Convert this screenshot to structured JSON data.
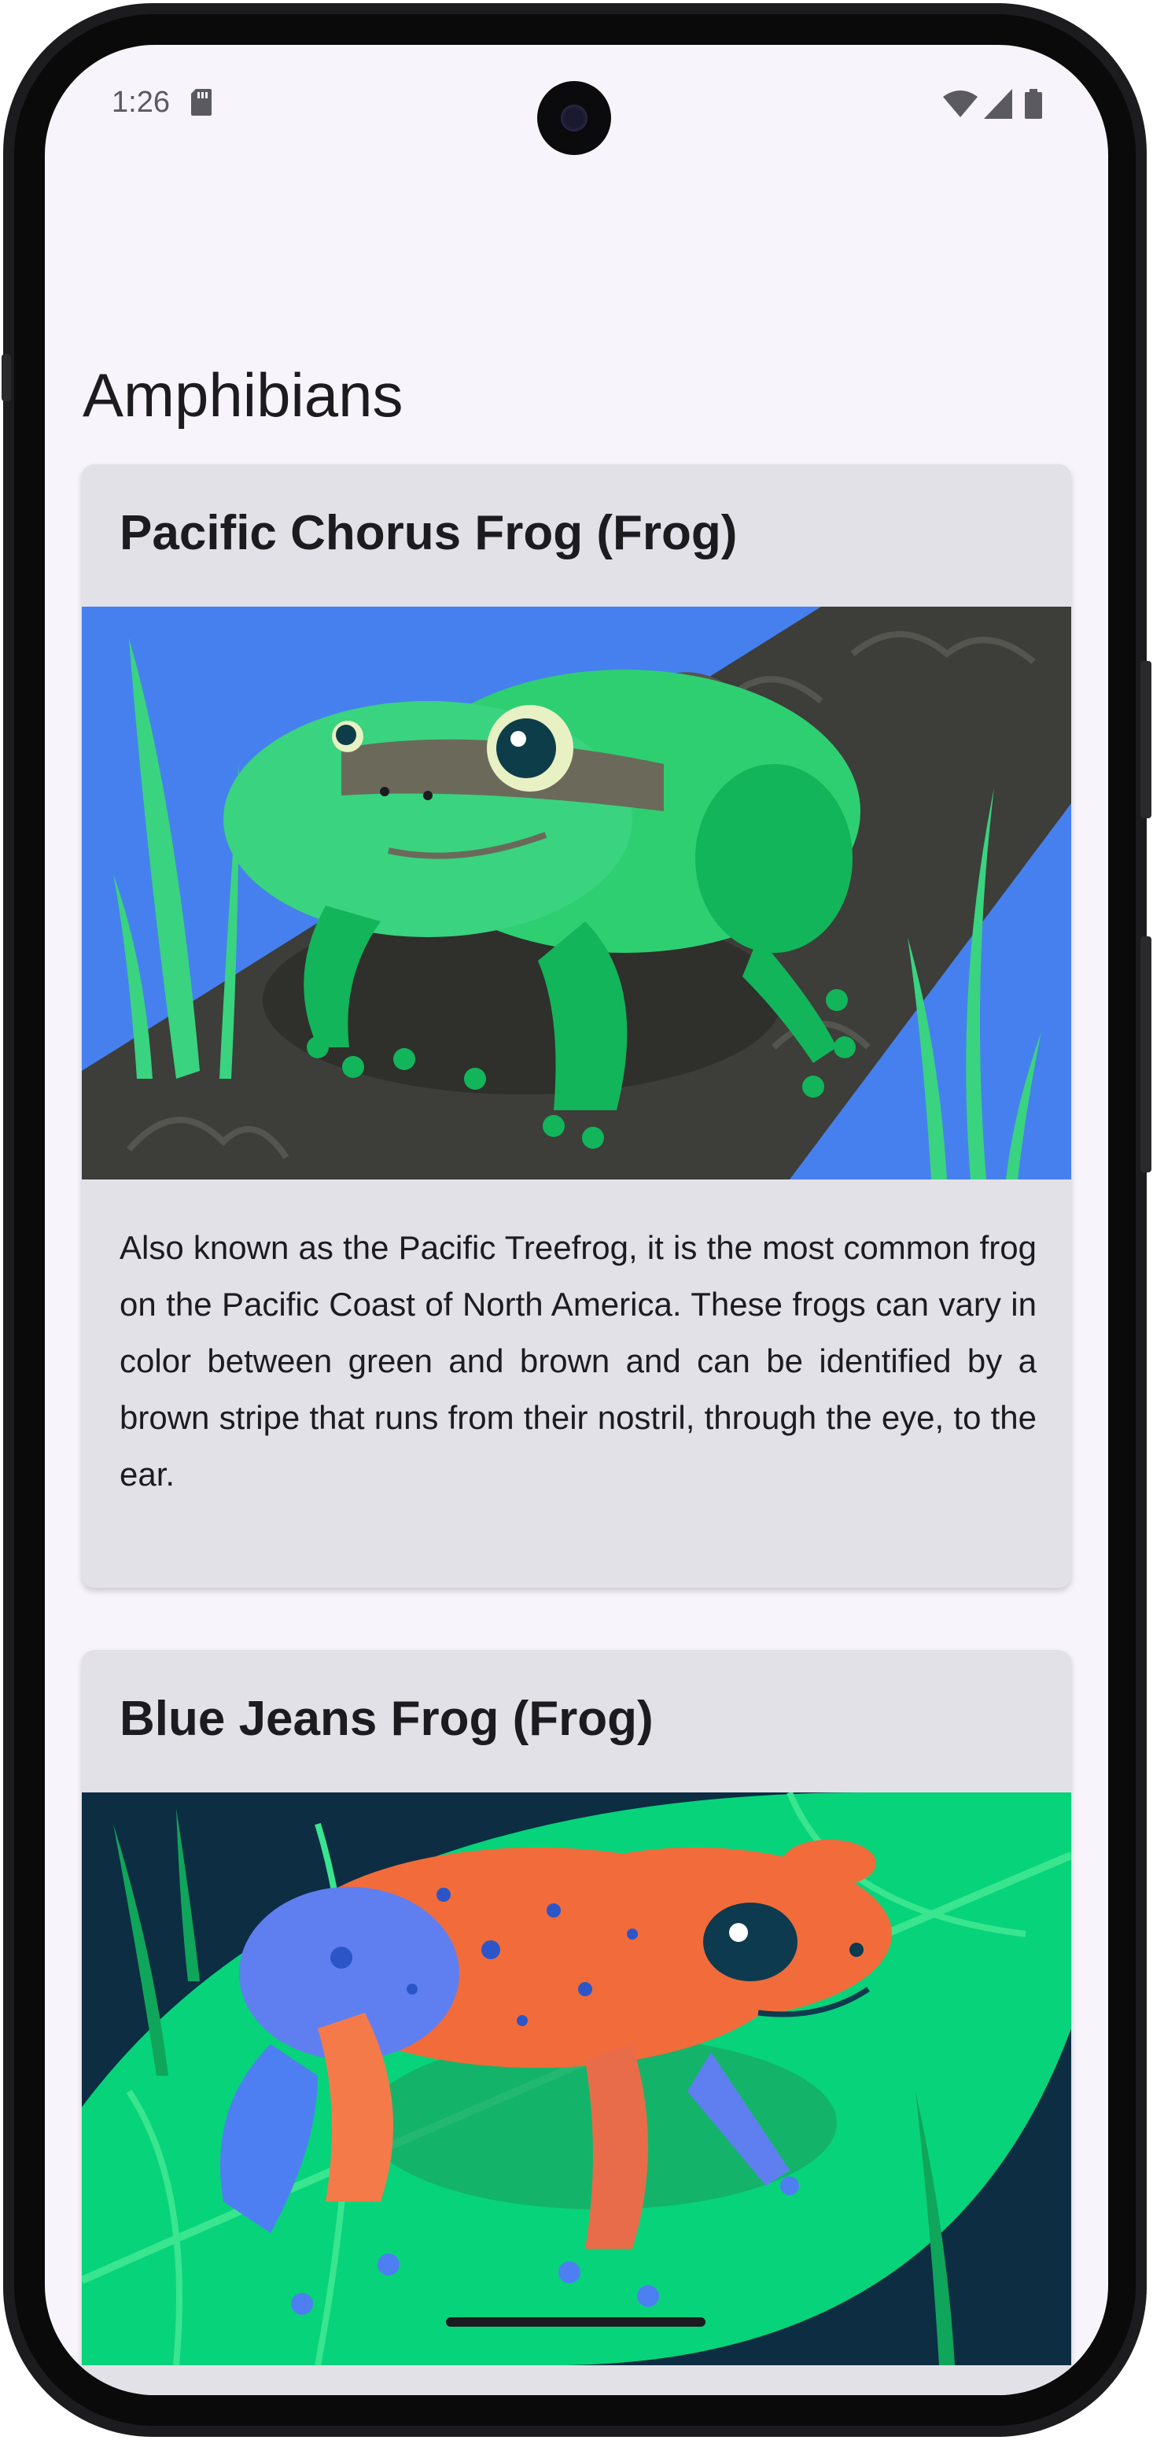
{
  "status_bar": {
    "time": "1:26",
    "icons": [
      "sd-card-icon",
      "wifi-icon",
      "cellular-signal-icon",
      "battery-icon"
    ]
  },
  "page": {
    "title": "Amphibians"
  },
  "cards": [
    {
      "title": "Pacific Chorus Frog (Frog)",
      "image": "pacific-chorus-frog-illustration",
      "description": "Also known as the Pacific Treefrog, it is the most common frog on the Pacific Coast of North America. These frogs can vary in color between green and brown and can be identified by a brown stripe that runs from their nostril, through the eye, to the ear."
    },
    {
      "title": "Blue Jeans Frog (Frog)",
      "image": "blue-jeans-frog-illustration"
    }
  ],
  "colors": {
    "screen_background": "#f7f5fb",
    "card_background": "#e3e1e8",
    "text_primary": "#1c1b1f"
  }
}
